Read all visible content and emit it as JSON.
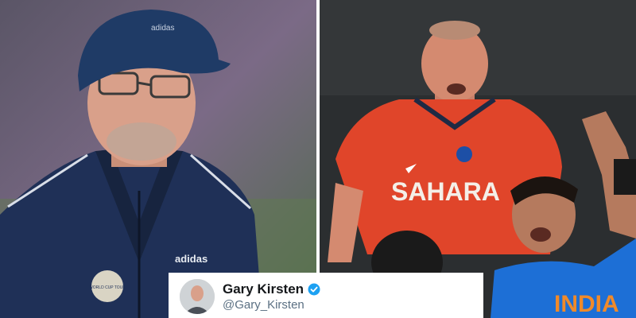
{
  "left_photo": {
    "cap_brand": "adidas",
    "jacket_brand": "adidas",
    "badge_text": "WORLD CUP TOUR",
    "colors": {
      "jacket": "#1f3057",
      "cap": "#1f3b66",
      "background": "#6a5d7a"
    }
  },
  "right_photo": {
    "jersey_text": "SAHARA",
    "front_jersey_text": "INDIA",
    "colors": {
      "jersey": "#e0452a",
      "front_jersey": "#1d6fd6",
      "background": "#2b2e30"
    }
  },
  "tweet": {
    "name": "Gary Kirsten",
    "handle": "@Gary_Kirsten",
    "verified_icon": "verified-badge-icon",
    "colors": {
      "verified": "#1da1f2",
      "name": "#14171a",
      "handle": "#5b7083"
    }
  }
}
